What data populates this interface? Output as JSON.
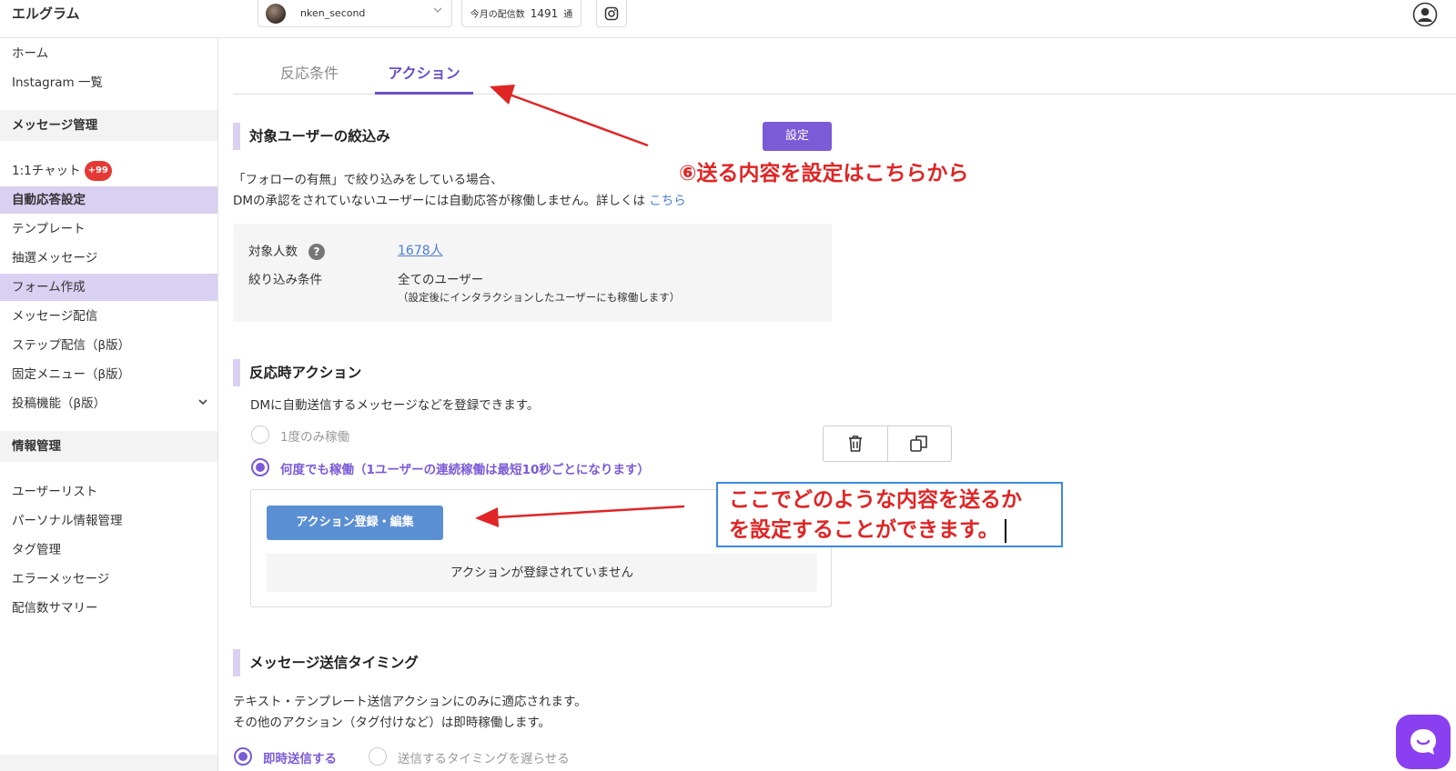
{
  "app": {
    "brand": "エルグラム"
  },
  "topbar": {
    "account_name": "nken_second",
    "counter_label": "今月の配信数",
    "counter_value": "1491",
    "counter_unit": "通"
  },
  "sidebar": {
    "home": "ホーム",
    "instagram_list": "Instagram 一覧",
    "section_message": "メッセージ管理",
    "chat": "1:1チャット",
    "chat_badge": "+99",
    "auto_reply": "自動応答設定",
    "template": "テンプレート",
    "lottery": "抽選メッセージ",
    "form": "フォーム作成",
    "broadcast": "メッセージ配信",
    "step": "ステップ配信（β版）",
    "fixed_menu": "固定メニュー（β版）",
    "post": "投稿機能（β版）",
    "section_info": "情報管理",
    "user_list": "ユーザーリスト",
    "personal_info": "パーソナル情報管理",
    "tags": "タグ管理",
    "errors": "エラーメッセージ",
    "summary": "配信数サマリー"
  },
  "tabs": [
    {
      "label": "反応条件"
    },
    {
      "label": "アクション"
    }
  ],
  "target": {
    "title": "対象ユーザーの絞込み",
    "set_button": "設定",
    "note_line1": "「フォローの有無」で絞り込みをしている場合、",
    "note_line2": "DMの承認をされていないユーザーには自動応答が稼働しません。詳しくは",
    "note_link": "こちら",
    "count_label": "対象人数",
    "count_help": "?",
    "count_value": "1678人",
    "condition_label": "絞り込み条件",
    "condition_value": "全てのユーザー",
    "condition_sub": "（設定後にインタラクションしたユーザーにも稼働します）"
  },
  "reaction": {
    "title": "反応時アクション",
    "desc": "DMに自動送信するメッセージなどを登録できます。",
    "option_once": "1度のみ稼働",
    "option_many": "何度でも稼働（1ユーザーの連続稼働は最短10秒ごとになります）",
    "register_button": "アクション登録・編集",
    "empty": "アクションが登録されていません"
  },
  "timing": {
    "title": "メッセージ送信タイミング",
    "desc1": "テキスト・テンプレート送信アクションにのみに適応されます。",
    "desc2": "その他のアクション（タグ付けなど）は即時稼働します。",
    "option_now": "即時送信する",
    "option_delay": "送信するタイミングを遅らせる"
  },
  "annotations": {
    "step6": "⑥送る内容を設定はこちらから",
    "box_line1": "ここでどのような内容を送るか",
    "box_line2": "を設定することができます。"
  },
  "colors": {
    "accent": "#7b5bd6",
    "active_bg": "#d9d0f2",
    "annotation_red": "#e02525",
    "annotation_box": "#3a8be0",
    "register_blue": "#5b8fd4"
  }
}
